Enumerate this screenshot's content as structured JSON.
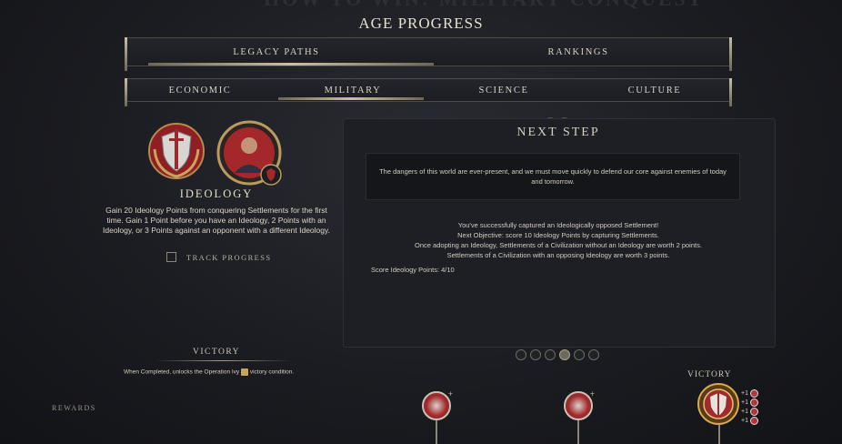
{
  "header": {
    "background_banner": "HOW TO WIN: MILITARY CONQUEST",
    "title": "AGE PROGRESS"
  },
  "main_tabs": [
    {
      "label": "LEGACY PATHS",
      "active": true
    },
    {
      "label": "RANKINGS",
      "active": false
    }
  ],
  "category_tabs": [
    {
      "label": "ECONOMIC",
      "active": false
    },
    {
      "label": "MILITARY",
      "active": true
    },
    {
      "label": "SCIENCE",
      "active": false
    },
    {
      "label": "CULTURE",
      "active": false
    }
  ],
  "milestone": {
    "name": "IDEOLOGY",
    "description": "Gain 20 Ideology Points from conquering Settlements for the first time. Gain 1 Point before you have an Ideology, 2 Points with an Ideology, or 3 Points against an opponent with a different Ideology.",
    "track_label": "TRACK PROGRESS",
    "track_checked": false,
    "icons": [
      "shield-sword-laurel-icon",
      "leader-portrait-icon"
    ]
  },
  "next_step": {
    "title": "NEXT STEP",
    "quote": "The dangers of this world are ever-present, and we must move quickly to defend our core against enemies of today and tomorrow.",
    "progress_lines": [
      "You've successfully captured an Ideologically opposed Settlement!",
      "Next Objective: score 10 Ideology Points by capturing Settlements.",
      "Once adopting an Ideology, Settlements of a Civilization without an Ideology are worth 2 points.",
      "Settlements of a Civilization with an opposing Ideology are worth 3 points."
    ],
    "score_label": "Score Ideology Points: 4/10",
    "pager": {
      "count": 6,
      "active_index": 3
    }
  },
  "victory_left": {
    "label": "VICTORY",
    "text_before": "When Completed, unlocks the Operation Ivy",
    "text_after": "victory condition."
  },
  "rewards": {
    "label": "REWARDS",
    "victory_label": "VICTORY",
    "bonuses": [
      "+1",
      "+1",
      "+1",
      "+1"
    ]
  },
  "colors": {
    "accent_red": "#a32a2c",
    "gold": "#cdbf9c",
    "panel": "#1d1f24"
  }
}
